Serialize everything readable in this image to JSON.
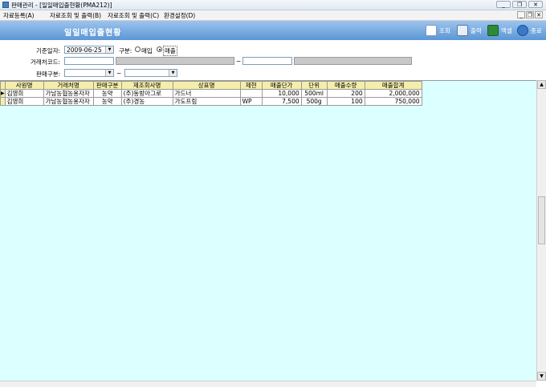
{
  "window": {
    "title": "판매관리 - [일일매입출현황(PMA212)]",
    "controls": [
      "_",
      "❐",
      "✕"
    ]
  },
  "menu": {
    "items": [
      "자료등록(A)",
      "자료조회 및 출력(B)",
      "자료조회 및 출력(C)",
      "환경설정(D)"
    ],
    "mdi_controls": [
      "_",
      "❐",
      "✕"
    ]
  },
  "header": {
    "title": "일일매입출현황"
  },
  "toolbar": [
    {
      "label": "조회",
      "icon": "search-document-icon"
    },
    {
      "label": "출력",
      "icon": "printer-icon"
    },
    {
      "label": "엑셀",
      "icon": "excel-icon"
    },
    {
      "label": "종료",
      "icon": "power-icon"
    }
  ],
  "form": {
    "date_label": "기준일자:",
    "date_value": "2009-06-25",
    "type_label": "구분:",
    "type_options": [
      "매입",
      "매출"
    ],
    "type_selected": "매출",
    "vendor_label": "거래처코드:",
    "tilde": "~",
    "sales_type_label": "판매구분:",
    "sales_type_from": "",
    "sales_type_to": ""
  },
  "grid": {
    "columns": [
      "사원명",
      "거래처명",
      "판매구분",
      "제조회사명",
      "상표명",
      "제현",
      "매출단가",
      "단위",
      "매출수량",
      "매출합계"
    ],
    "rows": [
      [
        "김영희",
        "가남농협농용자자",
        "농약",
        "(주)동방아그로",
        "가드너",
        "",
        "10,000",
        "500ml",
        "200",
        "2,000,000"
      ],
      [
        "김영희",
        "가남농협농용자자",
        "농약",
        "(주)경농",
        "가도프림",
        "WP",
        "7,500",
        "500g",
        "100",
        "750,000"
      ]
    ]
  }
}
